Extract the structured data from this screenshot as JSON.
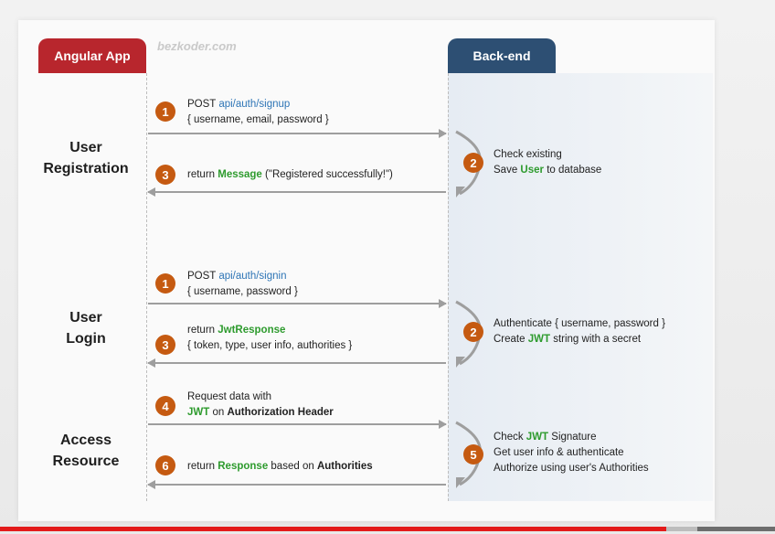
{
  "header": {
    "left_tab": "Angular App",
    "right_tab": "Back-end",
    "watermark": "bezkoder.com"
  },
  "sections": {
    "registration": {
      "line1": "User",
      "line2": "Registration"
    },
    "login": {
      "line1": "User",
      "line2": "Login"
    },
    "access": {
      "line1": "Access",
      "line2": "Resource"
    }
  },
  "steps": {
    "reg1": {
      "num": "1",
      "method": "POST ",
      "url": "api/auth/signup",
      "body": "{ username, email, password }"
    },
    "reg2": {
      "num": "2",
      "line1": "Check existing",
      "line2_a": "Save ",
      "line2_b": "User",
      "line2_c": " to database"
    },
    "reg3": {
      "num": "3",
      "a": "return ",
      "b": "Message",
      "c": " (\"Registered successfully!\")"
    },
    "log1": {
      "num": "1",
      "method": "POST ",
      "url": "api/auth/signin",
      "body": "{ username, password }"
    },
    "log2": {
      "num": "2",
      "line1": "Authenticate { username, password }",
      "line2_a": "Create ",
      "line2_b": "JWT",
      "line2_c": " string with a secret"
    },
    "log3": {
      "num": "3",
      "a": "return ",
      "b": "JwtResponse",
      "line2": "{ token, type, user info, authorities }"
    },
    "acc4": {
      "num": "4",
      "line1": "Request  data with",
      "line2_a": "JWT",
      "line2_b": " on ",
      "line2_c": "Authorization Header"
    },
    "acc5": {
      "num": "5",
      "line1_a": "Check ",
      "line1_b": "JWT",
      "line1_c": " Signature",
      "line2": "Get user info & authenticate",
      "line3": "Authorize using user's Authorities"
    },
    "acc6": {
      "num": "6",
      "a": "return ",
      "b": "Response",
      "c": " based on ",
      "d": "Authorities"
    }
  },
  "player": {
    "progress": 0.86,
    "buffered": 0.9
  }
}
